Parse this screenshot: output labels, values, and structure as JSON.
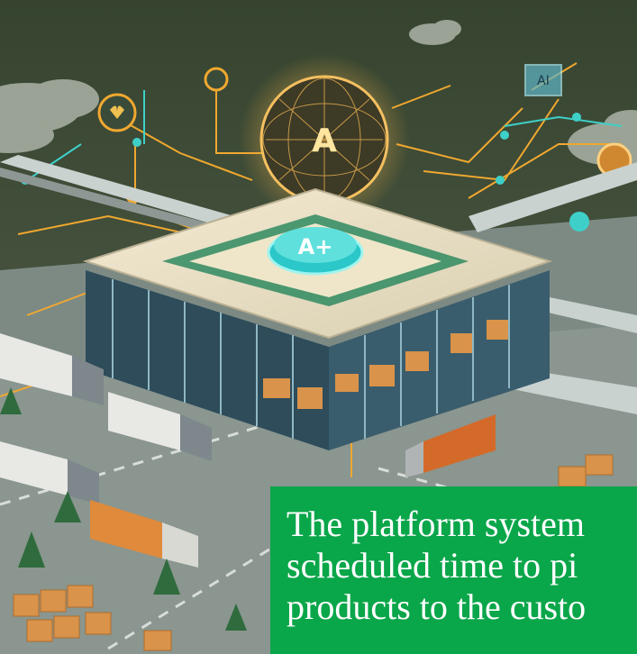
{
  "image": {
    "description_colors": {
      "sky": "#3f4d3a",
      "ground": "#7f8c86",
      "accent_orange": "#f0a830",
      "accent_teal": "#3ed0c8",
      "caption_bg": "#0aa64a"
    },
    "badge_glyph": "A"
  },
  "caption": {
    "line1": "The platform system",
    "line2": "scheduled time to pi",
    "line3": "products to the custo"
  }
}
